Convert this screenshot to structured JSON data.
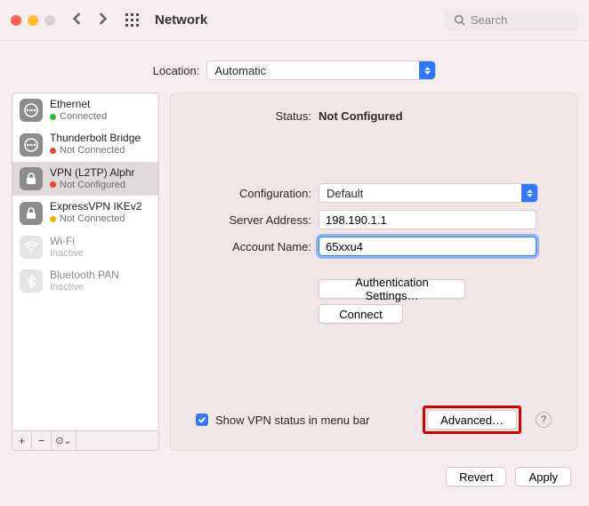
{
  "title": "Network",
  "search": {
    "placeholder": "Search"
  },
  "location": {
    "label": "Location:",
    "value": "Automatic"
  },
  "sidebar": {
    "items": [
      {
        "name": "Ethernet",
        "status": "Connected",
        "dot": "green",
        "icon": "ethernet",
        "selected": false,
        "dim": false
      },
      {
        "name": "Thunderbolt Bridge",
        "status": "Not Connected",
        "dot": "red",
        "icon": "ethernet",
        "selected": false,
        "dim": false
      },
      {
        "name": "VPN (L2TP) Alphr",
        "status": "Not Configured",
        "dot": "red",
        "icon": "lock",
        "selected": true,
        "dim": false
      },
      {
        "name": "ExpressVPN IKEv2",
        "status": "Not Connected",
        "dot": "yellow",
        "icon": "lock",
        "selected": false,
        "dim": false
      },
      {
        "name": "Wi-Fi",
        "status": "Inactive",
        "dot": "",
        "icon": "wifi",
        "selected": false,
        "dim": true
      },
      {
        "name": "Bluetooth PAN",
        "status": "Inactive",
        "dot": "",
        "icon": "bluetooth",
        "selected": false,
        "dim": true
      }
    ],
    "footer": {
      "add": "+",
      "remove": "−",
      "options": "⊙⌄"
    }
  },
  "main": {
    "status_label": "Status:",
    "status_value": "Not Configured",
    "config_label": "Configuration:",
    "config_value": "Default",
    "server_label": "Server Address:",
    "server_value": "198.190.1.1",
    "account_label": "Account Name:",
    "account_value": "65xxu4",
    "auth_button": "Authentication Settings…",
    "connect_button": "Connect",
    "checkbox_label": "Show VPN status in menu bar",
    "advanced_button": "Advanced…",
    "help": "?"
  },
  "window_actions": {
    "revert": "Revert",
    "apply": "Apply"
  }
}
